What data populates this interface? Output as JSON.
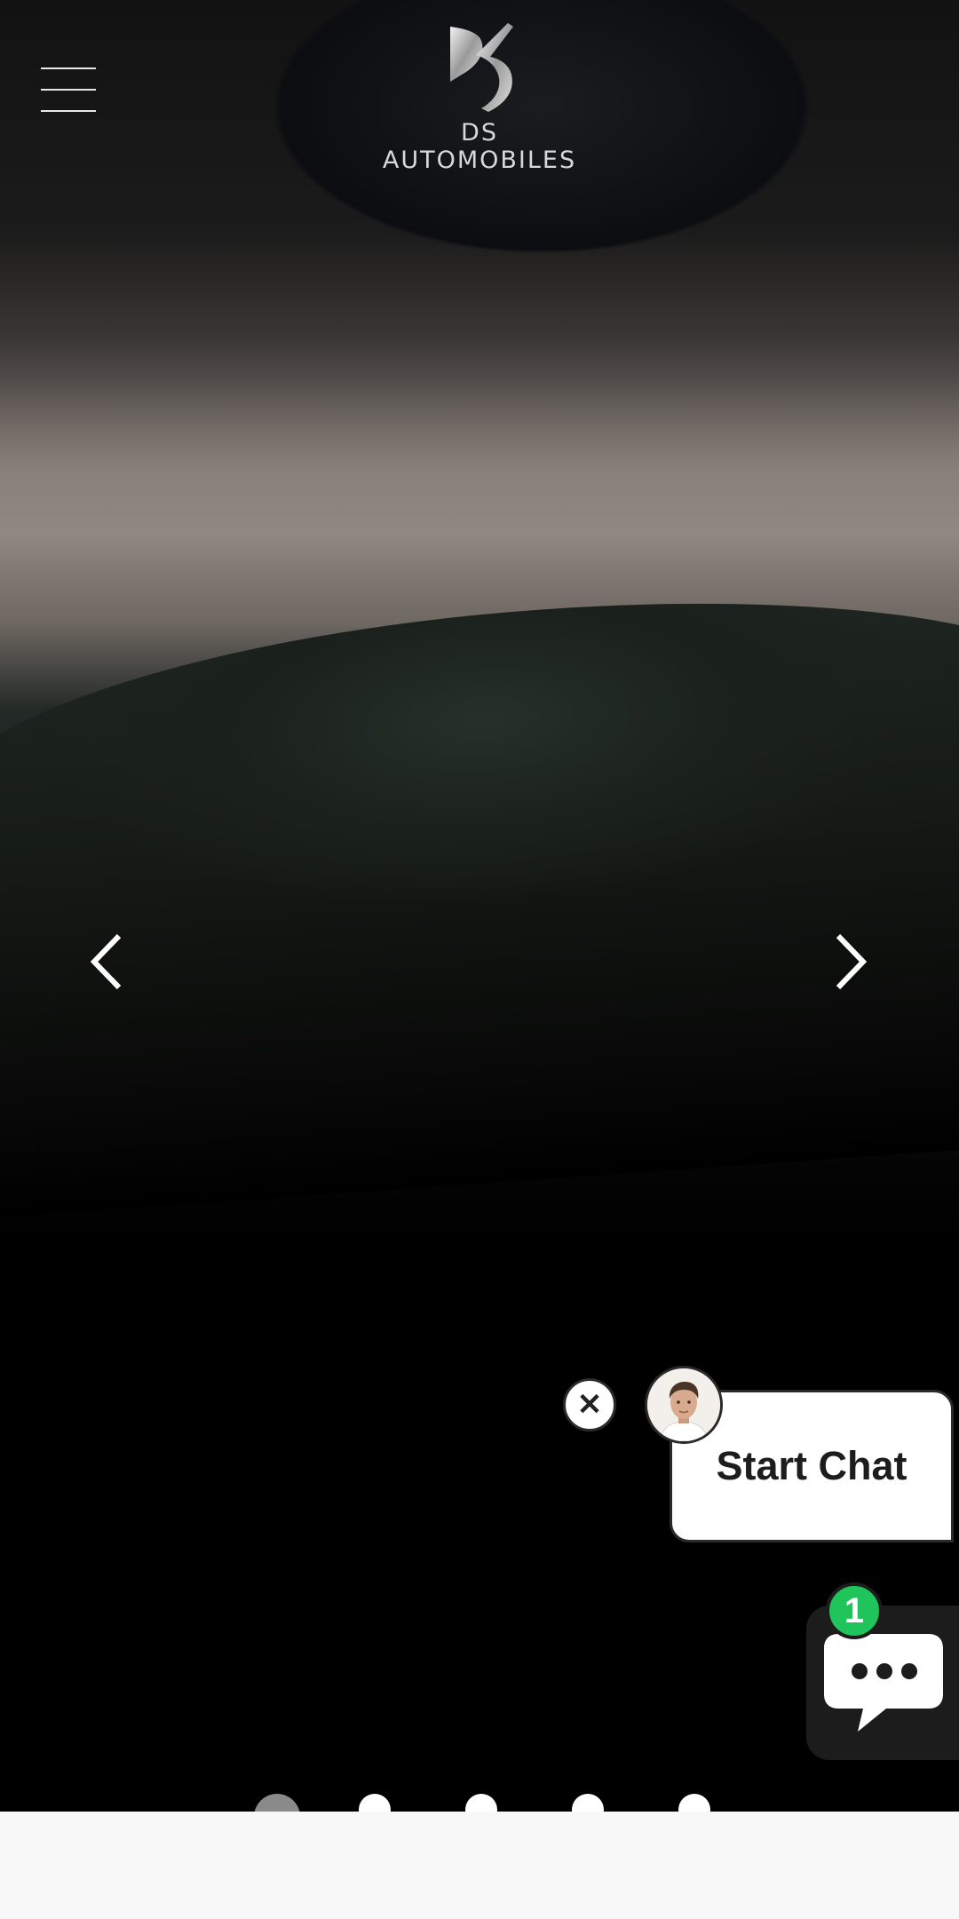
{
  "header": {
    "brand_name": "DS AUTOMOBILES",
    "menu_icon": "hamburger-menu-icon",
    "logo_icon": "ds-logo-icon"
  },
  "carousel": {
    "prev_icon": "chevron-left-icon",
    "next_icon": "chevron-right-icon",
    "slide_count": 5,
    "active_slide": 1
  },
  "chat_widget": {
    "close_glyph": "✕",
    "cta_label": "Start Chat",
    "unread_count": "1",
    "launcher_icon": "chat-bubble-icon",
    "avatar_icon": "agent-avatar-icon",
    "badge_color": "#1fc55a"
  }
}
